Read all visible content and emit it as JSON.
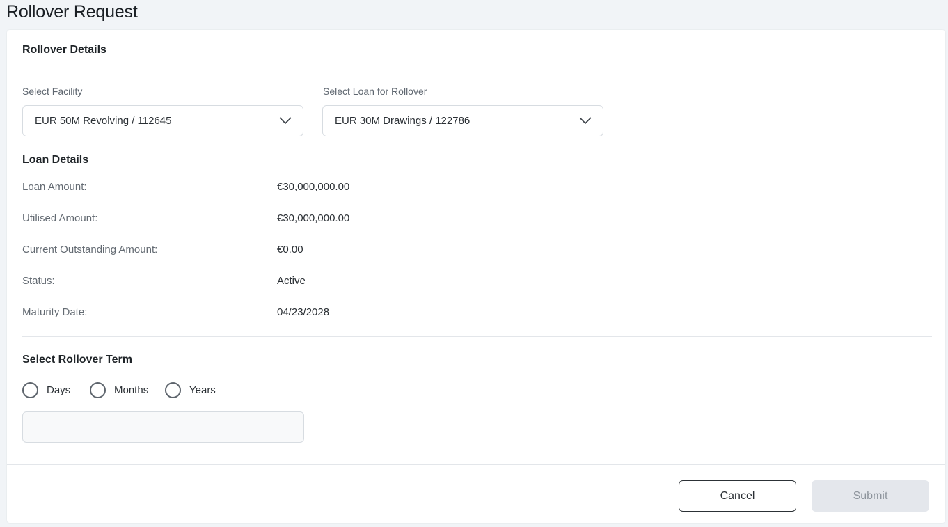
{
  "page": {
    "title": "Rollover Request"
  },
  "card": {
    "title": "Rollover Details"
  },
  "facility": {
    "label": "Select Facility",
    "value": "EUR 50M Revolving / 112645"
  },
  "loan_select": {
    "label": "Select Loan for Rollover",
    "value": "EUR 30M Drawings / 122786"
  },
  "loan_details": {
    "title": "Loan Details",
    "rows": [
      {
        "label": "Loan Amount:",
        "value": "€30,000,000.00"
      },
      {
        "label": "Utilised Amount:",
        "value": "€30,000,000.00"
      },
      {
        "label": "Current Outstanding Amount:",
        "value": "€0.00"
      },
      {
        "label": "Status:",
        "value": "Active"
      },
      {
        "label": "Maturity Date:",
        "value": "04/23/2028"
      }
    ]
  },
  "rollover_term": {
    "title": "Select Rollover Term",
    "options": [
      {
        "label": "Days",
        "selected": false
      },
      {
        "label": "Months",
        "selected": false
      },
      {
        "label": "Years",
        "selected": false
      }
    ],
    "input_value": "",
    "input_placeholder": ""
  },
  "actions": {
    "cancel_label": "Cancel",
    "submit_label": "Submit"
  },
  "colors": {
    "border": "#d7dce1",
    "submit_disabled_bg": "#e4e7ec",
    "submit_disabled_text": "#8d949c"
  },
  "icons": {
    "dropdown": "chevron-down-icon"
  }
}
